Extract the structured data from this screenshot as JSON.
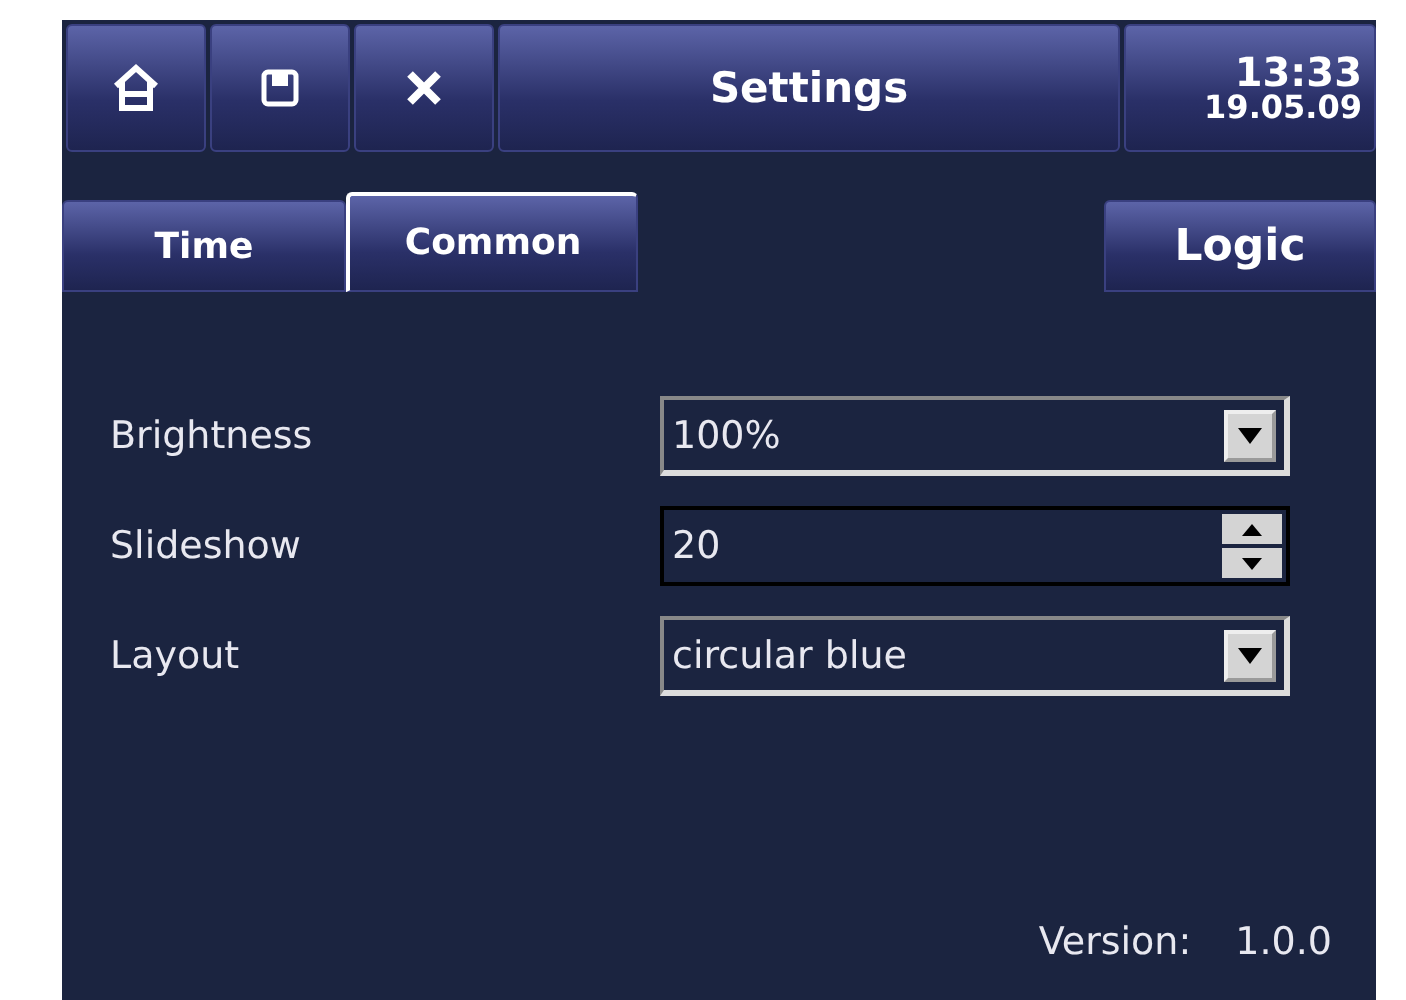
{
  "header": {
    "title": "Settings",
    "time": "13:33",
    "date": "19.05.09"
  },
  "tabs": [
    {
      "label": "Time",
      "selected": false
    },
    {
      "label": "Common",
      "selected": true
    },
    {
      "label": "Logic",
      "selected": false
    }
  ],
  "fields": [
    {
      "label": "Brightness",
      "kind": "dropdown",
      "value": "100%"
    },
    {
      "label": "Slideshow",
      "kind": "spinner",
      "value": "20"
    },
    {
      "label": "Layout",
      "kind": "dropdown",
      "value": "circular blue"
    }
  ],
  "version": {
    "label": "Version:",
    "value": "1.0.0"
  }
}
